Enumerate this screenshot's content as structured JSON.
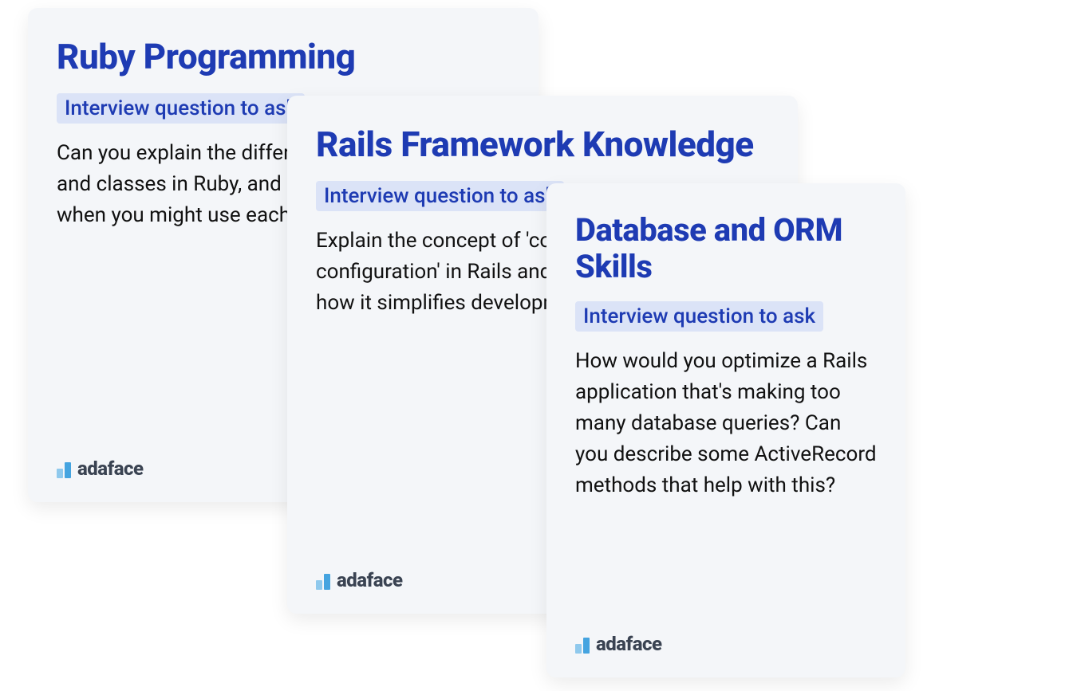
{
  "cards": [
    {
      "title": "Ruby Programming",
      "badge": "Interview question to ask",
      "question": "Can you explain the difference between modules and classes in Ruby, and provide an example of when you might use each?"
    },
    {
      "title": "Rails Framework Knowledge",
      "badge": "Interview question to ask",
      "question": "Explain the concept of 'convention over configuration' in Rails and provide an example of how it simplifies development."
    },
    {
      "title": "Database and ORM Skills",
      "badge": "Interview question to ask",
      "question": "How would you optimize a Rails application that's making too many database queries? Can you describe some ActiveRecord methods that help with this?"
    }
  ],
  "brand": "adaface"
}
